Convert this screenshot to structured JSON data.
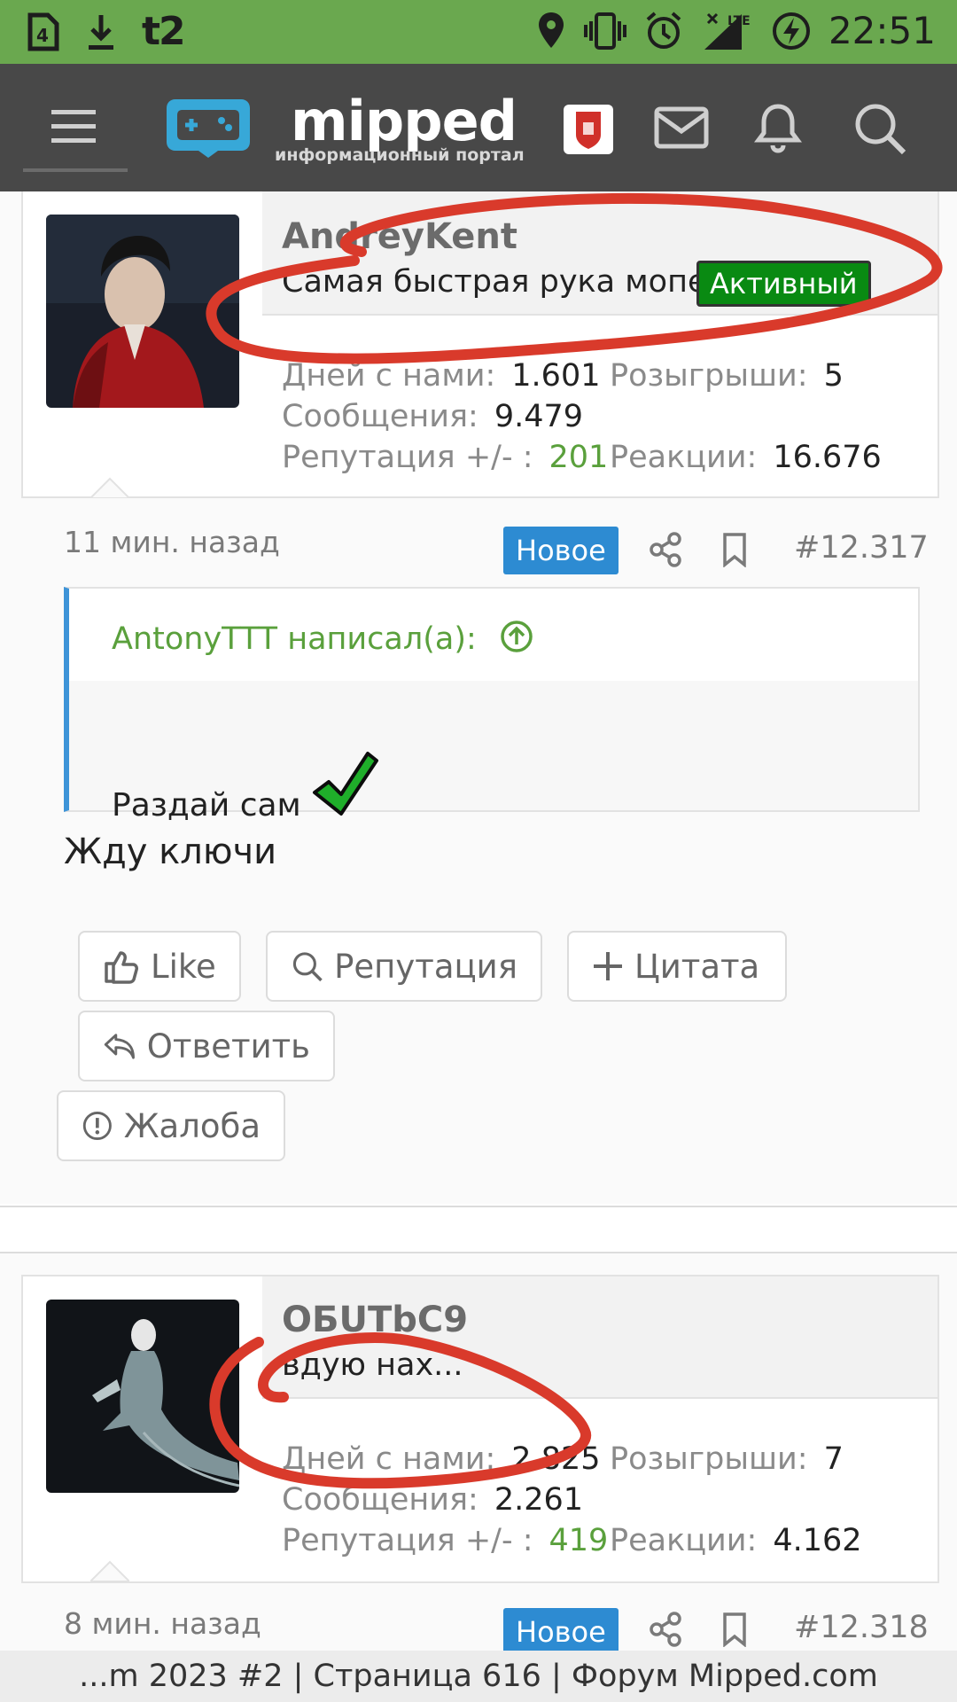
{
  "status_bar": {
    "carrier": "t2",
    "time": "22:51",
    "network": "LTE",
    "icons": [
      "sim-icon",
      "download-icon",
      "location-icon",
      "vibrate-icon",
      "alarm-icon",
      "signal-icon",
      "battery-charging-icon"
    ]
  },
  "app_bar": {
    "logo_name": "mipped",
    "logo_subtitle": "информационный портал",
    "actions": [
      "menu-icon",
      "region-icon",
      "mail-icon",
      "bell-icon",
      "search-icon"
    ]
  },
  "posts": [
    {
      "username": "AndreyKent",
      "user_title": "Самая быстрая рука мопеда",
      "status_badge": "Активный",
      "stats": {
        "days_label": "Дней с нами:",
        "days": "1.601",
        "giveaways_label": "Розыгрыши:",
        "giveaways": "5",
        "messages_label": "Сообщения:",
        "messages": "9.479",
        "reputation_label": "Репутация +/- :",
        "reputation": "201",
        "reactions_label": "Реакции:",
        "reactions": "16.676"
      },
      "time": "11 мин. назад",
      "new_badge": "Новое",
      "post_number": "#12.317",
      "quote": {
        "author": "AntonyTTT написал(а):",
        "text": "Раздай сам"
      },
      "text": "Жду ключи",
      "buttons": {
        "like": "Like",
        "reputation": "Репутация",
        "quote": "Цитата",
        "reply": "Ответить",
        "report": "Жалоба"
      }
    },
    {
      "username": "ОБUТbС9",
      "user_title": "вдую нах...",
      "stats": {
        "days_label": "Дней с нами:",
        "days": "2.825",
        "giveaways_label": "Розыгрыши:",
        "giveaways": "7",
        "messages_label": "Сообщения:",
        "messages": "2.261",
        "reputation_label": "Репутация +/- :",
        "reputation": "419",
        "reactions_label": "Реакции:",
        "reactions": "4.162"
      },
      "time": "8 мин. назад",
      "new_badge": "Новое",
      "post_number": "#12.318"
    }
  ],
  "footer": {
    "page_title": "...m 2023 #2 | Страница 616 | Форум Mipped.com"
  },
  "colors": {
    "status_bar": "#6aa84f",
    "app_bar": "#484848",
    "accent_blue": "#2d8bd2",
    "reputation_green": "#5aa03c",
    "active_badge": "#098a12",
    "annotation_red": "#d93a2b"
  }
}
